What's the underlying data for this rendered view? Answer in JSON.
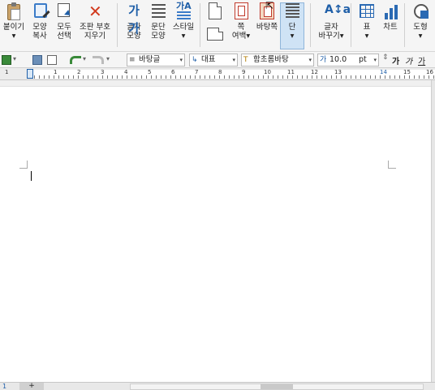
{
  "ribbon": {
    "buttons": [
      {
        "label": "붙이기\n▾",
        "name": "paste-button"
      },
      {
        "label": "모양\n복사",
        "name": "format-painter-button"
      },
      {
        "label": "모두\n선택",
        "name": "select-all-button"
      },
      {
        "label": "조판 부호\n지우기",
        "name": "clear-formatting-codes-button"
      },
      {
        "label": "글자\n모양",
        "name": "char-shape-button"
      },
      {
        "label": "문단\n모양",
        "name": "para-shape-button"
      },
      {
        "label": "스타일\n▾",
        "name": "style-button"
      },
      {
        "label": "",
        "name": "page-setup-button"
      },
      {
        "label": "쪽\n여백▾",
        "name": "page-margin-button"
      },
      {
        "label": "바탕쪽",
        "name": "master-page-button"
      },
      {
        "label": "단\n▾",
        "name": "columns-button"
      },
      {
        "label": "글자\n바꾸기▾",
        "name": "change-text-button"
      },
      {
        "label": "표\n▾",
        "name": "table-button"
      },
      {
        "label": "차트",
        "name": "chart-button"
      },
      {
        "label": "도형\n▾",
        "name": "shape-button"
      }
    ]
  },
  "toolbar": {
    "style_value": "바탕글",
    "lang_value": "대표",
    "font_value": "함초롬바탕",
    "size_value": "10.0",
    "unit_value": "pt",
    "bold_glyph": "가",
    "italic_glyph": "가",
    "underline_glyph": "가"
  },
  "ruler": {
    "numbers": [
      "1",
      "1",
      "2",
      "3",
      "4",
      "5",
      "6",
      "7",
      "8",
      "9",
      "10",
      "11",
      "12",
      "13",
      "14",
      "15",
      "16"
    ]
  },
  "statusbar": {
    "page": "1",
    "tab_label": "+"
  }
}
